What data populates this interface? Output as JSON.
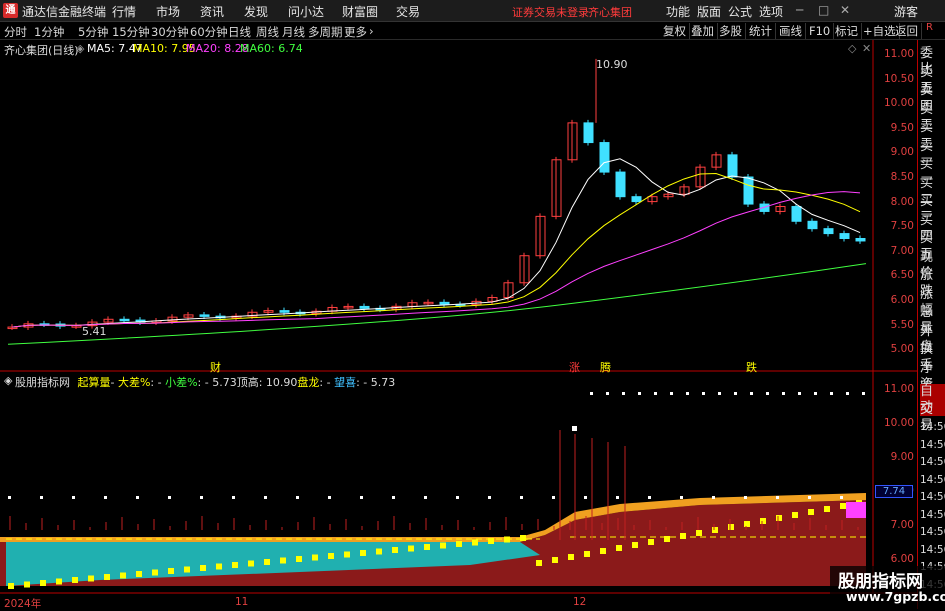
{
  "menubar": {
    "app_title": "通达信金融终端",
    "logo": "通",
    "items": [
      "行情",
      "市场",
      "资讯",
      "发现",
      "问小达",
      "财富圈",
      "交易"
    ],
    "notice": "证券交易未登录",
    "stock": "齐心集团",
    "right_items": [
      "功能",
      "版面",
      "公式",
      "选项"
    ],
    "window_icons": [
      "minimize-icon",
      "restore-icon",
      "close-icon"
    ],
    "user": "游客"
  },
  "periodbar": {
    "periods": [
      "分时",
      "1分钟",
      "5分钟",
      "15分钟",
      "30分钟",
      "60分钟",
      "日线",
      "周线",
      "月线",
      "多周期",
      "更多"
    ],
    "active_period": "日线",
    "tools": [
      "复权",
      "叠加",
      "多股",
      "统计",
      "画线",
      "F10",
      "标记",
      "+自选",
      "返回"
    ]
  },
  "main_chart": {
    "title": "齐心集团(日线)",
    "ma": [
      {
        "label": "MA5: 7.47",
        "color": "#ffffff"
      },
      {
        "label": "MA10: 7.95",
        "color": "#ffff00"
      },
      {
        "label": "MA20: 8.28",
        "color": "#ff40ff"
      },
      {
        "label": "MA60: 6.74",
        "color": "#40ff40"
      }
    ],
    "y_ticks": [
      "11.00",
      "10.50",
      "10.00",
      "9.50",
      "9.00",
      "8.50",
      "8.00",
      "7.50",
      "7.00",
      "6.50",
      "6.00",
      "5.50",
      "5.00"
    ],
    "high_label": "10.90",
    "low_label": "5.41",
    "markers": [
      {
        "text": "财",
        "color": "#ffff00"
      },
      {
        "text": "涨",
        "color": "#ff3b3b"
      },
      {
        "text": "腾",
        "color": "#ffff00"
      },
      {
        "text": "跌",
        "color": "#ffff00"
      }
    ],
    "corner_icons": [
      "diamond-icon",
      "close-icon"
    ]
  },
  "indicator": {
    "title": "股朋指标网",
    "items": [
      {
        "text": "起算量",
        "color": "#ffff00"
      },
      {
        "text": "- ",
        "color": "#dddddd"
      },
      {
        "text": "大差%",
        "color": "#ffff00"
      },
      {
        "text": ": - ",
        "color": "#dddddd"
      },
      {
        "text": "小差%",
        "color": "#40ff40"
      },
      {
        "text": ": - 5.73",
        "color": "#dddddd"
      },
      {
        "text": "顶高: 10.90",
        "color": "#dddddd"
      },
      {
        "text": "盘龙",
        "color": "#ffff00"
      },
      {
        "text": ": - ",
        "color": "#dddddd"
      },
      {
        "text": "望喜",
        "color": "#40c0ff"
      },
      {
        "text": ": - 5.73",
        "color": "#dddddd"
      }
    ],
    "y_ticks": [
      "11.00",
      "10.00",
      "9.00",
      "8.00",
      "7.00",
      "6.00"
    ],
    "current_value": "7.74"
  },
  "date_axis": [
    "2024年",
    "11",
    "12"
  ],
  "right_panel": {
    "items": [
      "委比",
      "卖五",
      "卖四",
      "卖三",
      "卖二",
      "卖一",
      "买一",
      "买二",
      "买三",
      "买四",
      "买五",
      "现价",
      "涨跌",
      "涨幅",
      "总量",
      "外盘",
      "换手",
      "净资",
      "收益"
    ],
    "items2": [
      "自动",
      "交易",
      "14:56",
      "14:56",
      "14:56",
      "14:56",
      "14:56",
      "14:56",
      "14:56",
      "14:56",
      "14:56",
      "14:56"
    ]
  },
  "watermark": {
    "line1": "股朋指标网",
    "line2": "www.7gpzb.com"
  }
}
